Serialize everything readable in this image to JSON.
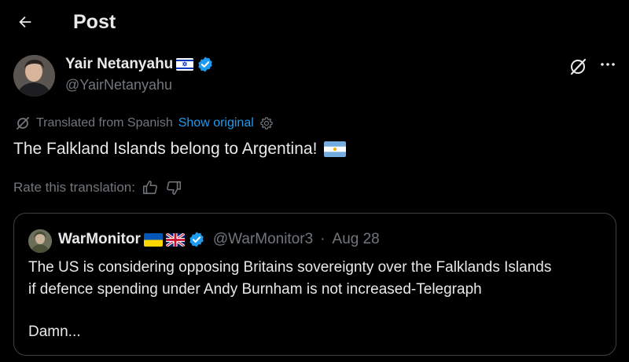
{
  "header": {
    "title": "Post",
    "back_icon": "arrow-left-icon"
  },
  "author": {
    "name": "Yair Netanyahu",
    "flag_icon": "israel-flag-icon",
    "verified_icon": "verified-badge-icon",
    "handle": "@YairNetanyahu"
  },
  "actions": {
    "grok_icon": "grok-icon",
    "more_icon": "more-options-icon"
  },
  "translation": {
    "label": "Translated from Spanish",
    "show_original": "Show original",
    "rate_label": "Rate this translation:"
  },
  "post": {
    "text": "The Falkland Islands belong to Argentina!",
    "flag_icon": "argentina-flag-icon"
  },
  "quote": {
    "name": "WarMonitor",
    "flag_icons": [
      "ukraine-flag-icon",
      "uk-flag-icon"
    ],
    "handle": "@WarMonitor3",
    "separator": "·",
    "date": "Aug 28",
    "line1": "The US is considering opposing Britains sovereignty over the Falklands Islands",
    "line2": "if defence spending under Andy Burnham is not increased-Telegraph",
    "line3": "Damn..."
  },
  "colors": {
    "background": "#000000",
    "text": "#e7e9ea",
    "muted": "#71767b",
    "link": "#1d9bf0",
    "verified": "#1d9bf0",
    "border": "#3e4144"
  }
}
